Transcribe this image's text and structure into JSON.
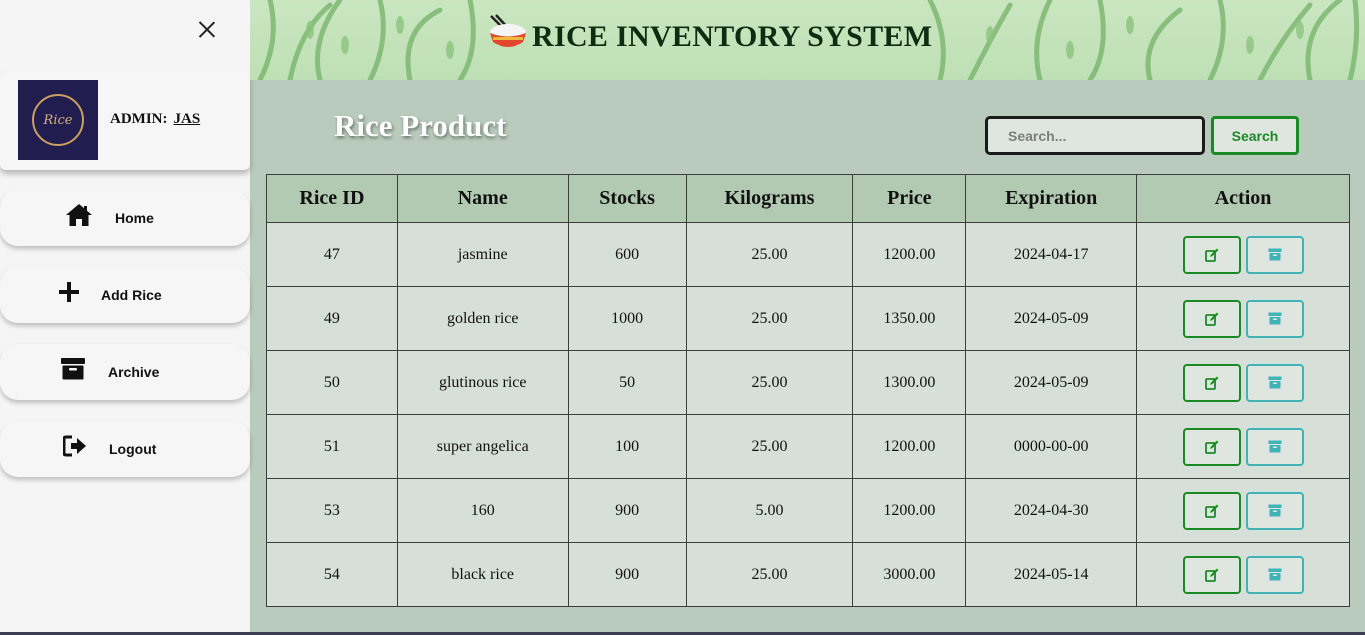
{
  "sidebar": {
    "admin_label": "ADMIN:",
    "admin_name": "JAS",
    "logo_text": "Rice",
    "nav": [
      {
        "label": "Home",
        "icon": "home-icon"
      },
      {
        "label": "Add Rice",
        "icon": "plus-icon"
      },
      {
        "label": "Archive",
        "icon": "archive-icon"
      },
      {
        "label": "Logout",
        "icon": "logout-icon"
      }
    ]
  },
  "header": {
    "title": "RICE INVENTORY SYSTEM"
  },
  "main": {
    "title": "Rice Product",
    "search_placeholder": "Search...",
    "search_button": "Search"
  },
  "table": {
    "columns": [
      "Rice ID",
      "Name",
      "Stocks",
      "Kilograms",
      "Price",
      "Expiration",
      "Action"
    ],
    "rows": [
      {
        "id": "47",
        "name": "jasmine",
        "stocks": "600",
        "kilograms": "25.00",
        "price": "1200.00",
        "expiration": "2024-04-17"
      },
      {
        "id": "49",
        "name": "golden rice",
        "stocks": "1000",
        "kilograms": "25.00",
        "price": "1350.00",
        "expiration": "2024-05-09"
      },
      {
        "id": "50",
        "name": "glutinous rice",
        "stocks": "50",
        "kilograms": "25.00",
        "price": "1300.00",
        "expiration": "2024-05-09"
      },
      {
        "id": "51",
        "name": "super angelica",
        "stocks": "100",
        "kilograms": "25.00",
        "price": "1200.00",
        "expiration": "0000-00-00"
      },
      {
        "id": "53",
        "name": "160",
        "stocks": "900",
        "kilograms": "5.00",
        "price": "1200.00",
        "expiration": "2024-04-30"
      },
      {
        "id": "54",
        "name": "black rice",
        "stocks": "900",
        "kilograms": "25.00",
        "price": "3000.00",
        "expiration": "2024-05-14"
      }
    ]
  },
  "colors": {
    "accent_green": "#1a8a24",
    "archive_teal": "#3fb3b8",
    "header_bg": "#c9e6c0",
    "main_bg": "#b9cbbd"
  }
}
